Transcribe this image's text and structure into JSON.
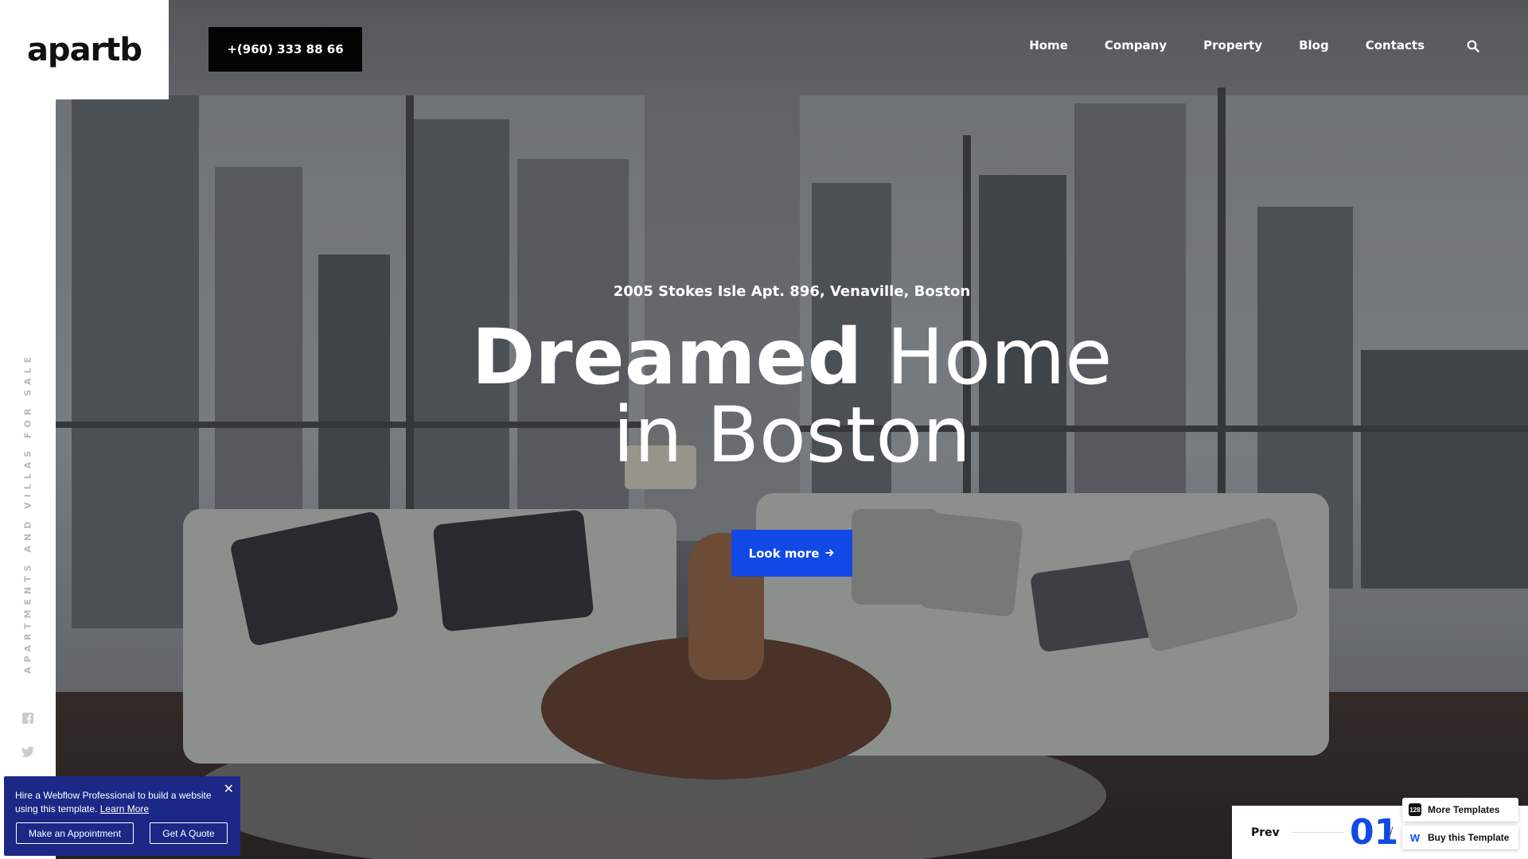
{
  "brand": {
    "logo": "apartb",
    "phone": "+(960) 333 88 66"
  },
  "nav": {
    "items": [
      "Home",
      "Company",
      "Property",
      "Blog",
      "Contacts"
    ],
    "search_icon": "search-icon"
  },
  "sidebar": {
    "vertical_text": "APARTMENTS AND VILLAS FOR SALE",
    "social": [
      "facebook-icon",
      "twitter-icon"
    ]
  },
  "hero": {
    "address": "2005 Stokes Isle Apt. 896, Venaville, Boston",
    "headline_bold": "Dreamed",
    "headline_rest": "Home",
    "headline_line2": "in Boston",
    "cta_label": "Look more",
    "cta_icon": "arrow-right-icon"
  },
  "hire_banner": {
    "text": "Hire a Webflow Professional to build a website using this template.",
    "link": "Learn More",
    "button1": "Make an Appointment",
    "button2": "Get A Quote"
  },
  "slider": {
    "prev_label": "Prev",
    "current": "01",
    "separator": "/"
  },
  "badges": {
    "more_templates": "More Templates",
    "more_icon_text": "128",
    "buy_template": "Buy this Template"
  },
  "colors": {
    "accent": "#1149e6",
    "banner": "#1c2886",
    "phone_bg": "#050505"
  }
}
